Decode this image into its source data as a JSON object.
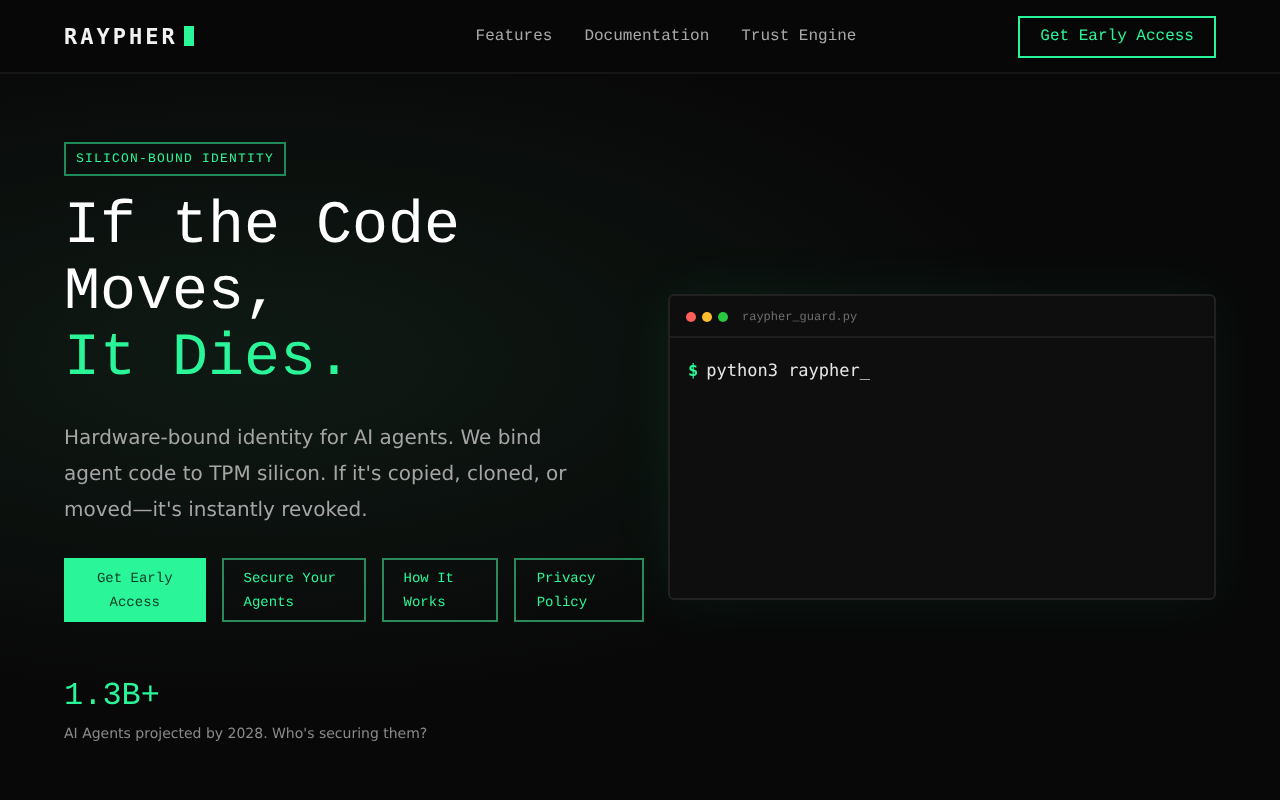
{
  "header": {
    "logo": "RAYPHER",
    "nav": [
      "Features",
      "Documentation",
      "Trust Engine"
    ],
    "cta": "Get Early Access"
  },
  "hero": {
    "badge": "SILICON-BOUND IDENTITY",
    "headline": [
      {
        "text": "If the Code",
        "accent": false
      },
      {
        "text": "Moves,",
        "accent": false
      },
      {
        "text": "It Dies.",
        "accent": true
      }
    ],
    "description": "Hardware-bound identity for AI agents. We bind agent code to TPM silicon. If it's copied, cloned, or moved—it's instantly revoked.",
    "buttons": [
      {
        "label": "Get Early Access",
        "kind": "primary"
      },
      {
        "label": "Secure Your Agents",
        "kind": "outline"
      },
      {
        "label": "How It Works",
        "kind": "outline"
      },
      {
        "label": "Privacy Policy",
        "kind": "outline"
      }
    ],
    "stat": {
      "value": "1.3B+",
      "caption": "AI Agents projected by 2028. Who's securing them?"
    }
  },
  "terminal": {
    "dots": [
      {
        "color": "#ff5f57"
      },
      {
        "color": "#febc2e"
      },
      {
        "color": "#28c840"
      }
    ],
    "filename": "raypher_guard.py",
    "prompt": "$",
    "command": "python3 raypher_"
  }
}
